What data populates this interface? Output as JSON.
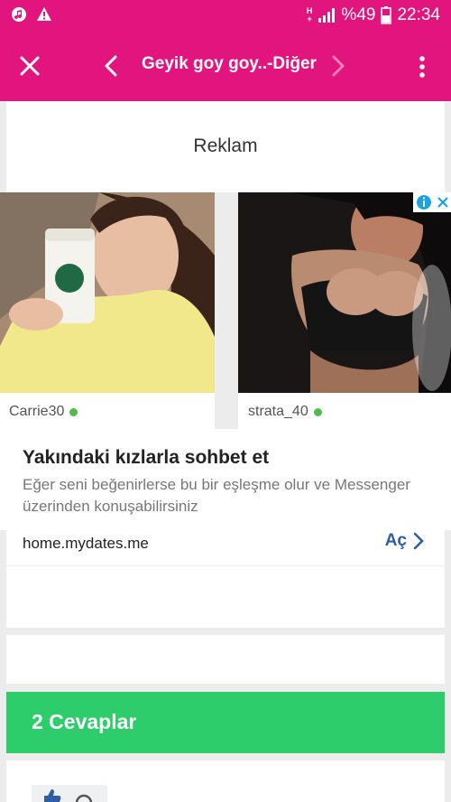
{
  "statusbar": {
    "network_label_top": "H",
    "network_label_bottom": "+",
    "battery": "%49",
    "time": "22:34"
  },
  "appbar": {
    "title": "Geyik goy goy..-Diğer"
  },
  "ad": {
    "label": "Reklam",
    "profiles": [
      {
        "name": "Carrie30"
      },
      {
        "name": "strata_40"
      }
    ],
    "headline": "Yakındaki kızlarla sohbet et",
    "description": "Eğer seni beğenirlerse bu bir eşleşme olur ve Messenger üzerinden konuşabilirsiniz",
    "url": "home.mydates.me",
    "cta": "Aç"
  },
  "answers": {
    "title": "2 Cevaplar"
  },
  "colors": {
    "brand_pink": "#e2157e",
    "answers_green": "#2ecd6b",
    "online_dot": "#4cbe4c",
    "cta_blue": "#2f5ea5"
  },
  "icons": [
    "music-icon",
    "warning-icon",
    "signal-icon",
    "battery-icon",
    "close-icon",
    "chevron-left-icon",
    "chevron-right-icon",
    "more-vert-icon",
    "info-icon",
    "ad-close-icon",
    "chevron-right-icon",
    "thumb-up-icon"
  ]
}
